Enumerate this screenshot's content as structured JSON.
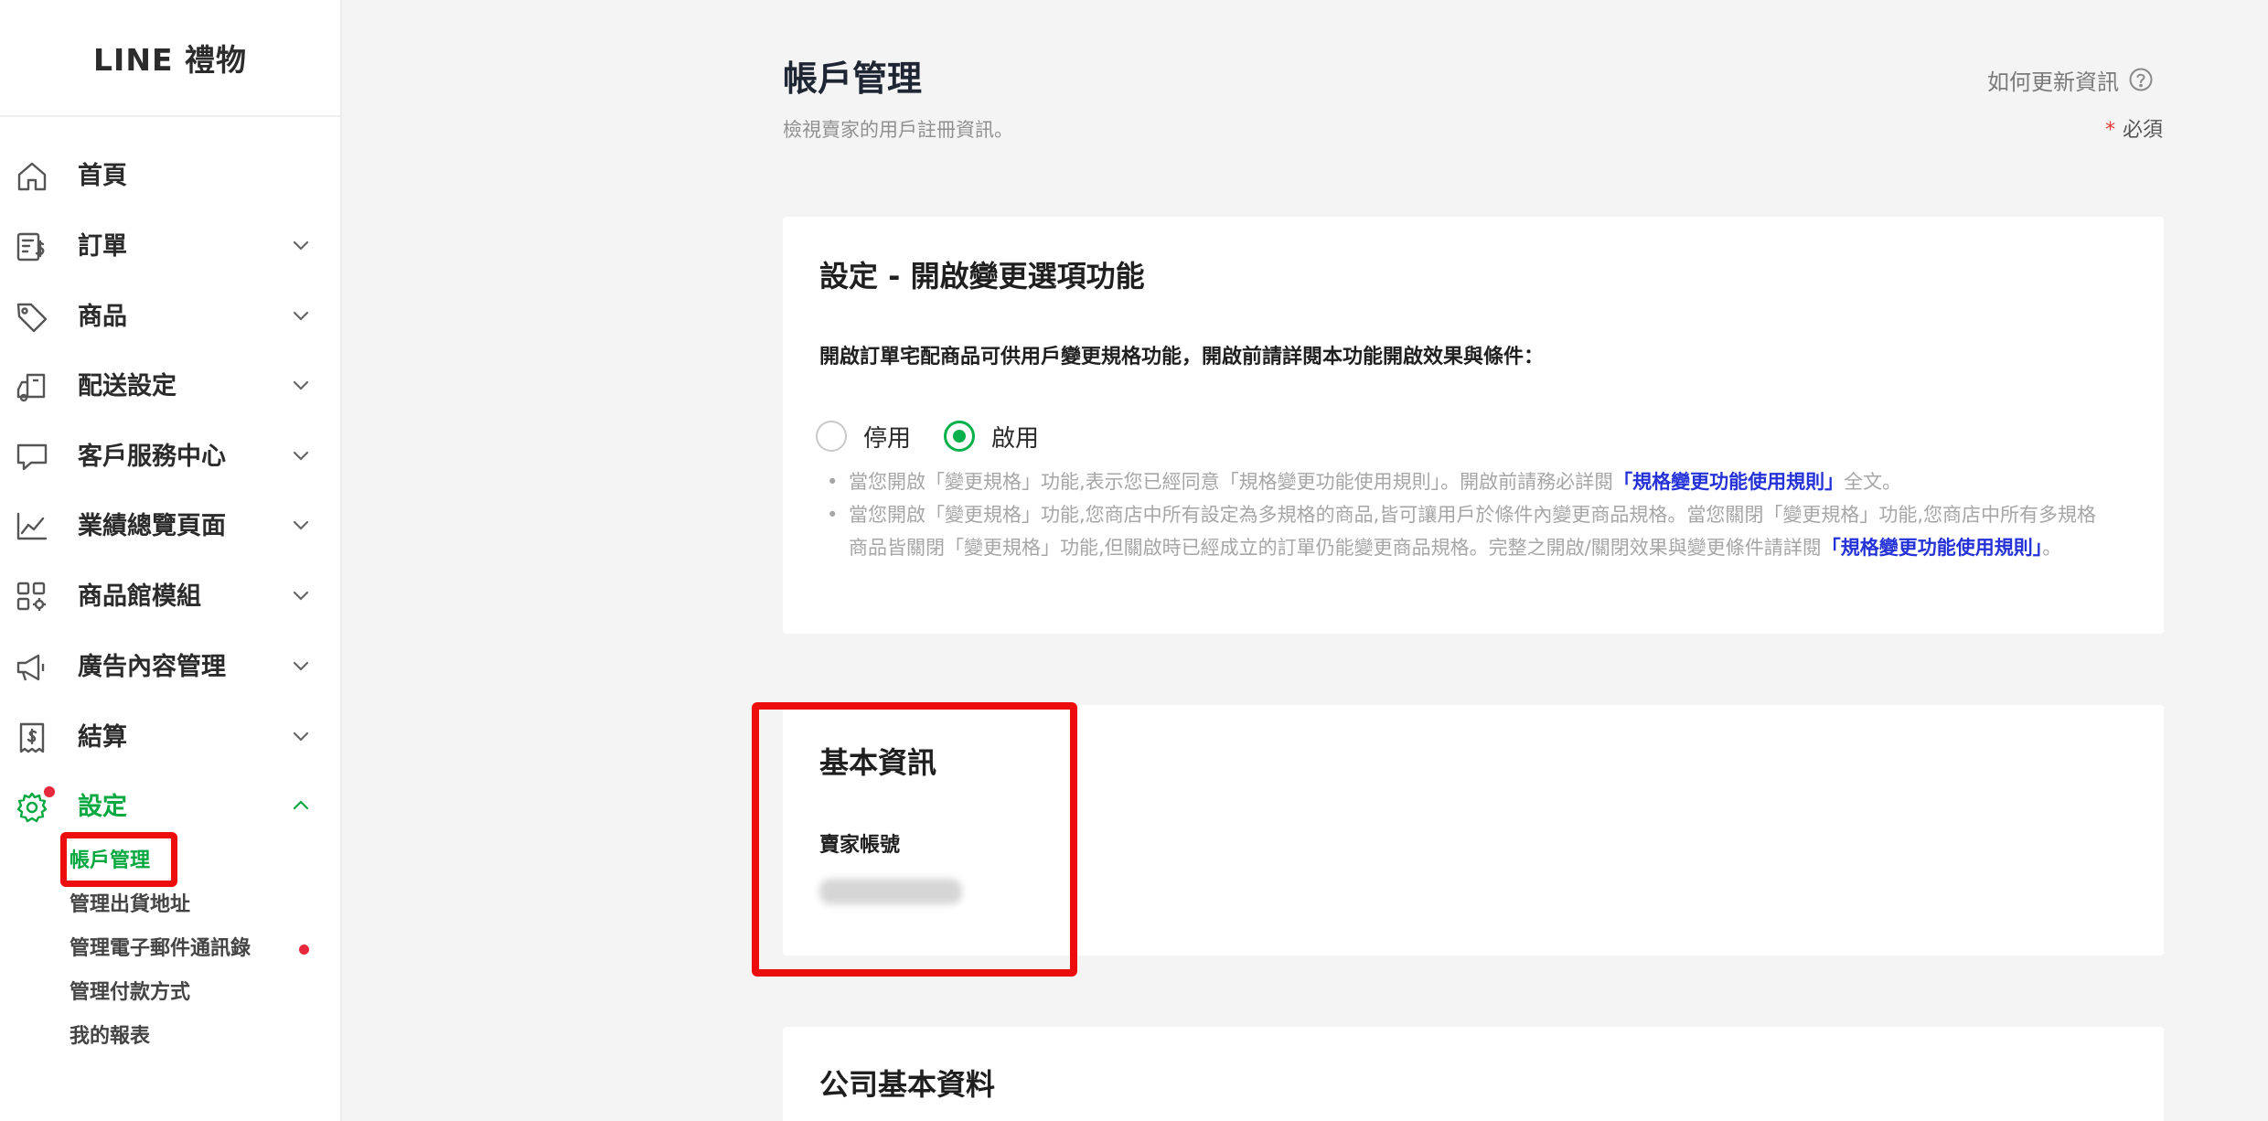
{
  "brand": {
    "logo_text": "LINE 禮物"
  },
  "sidebar": {
    "items": [
      {
        "label": "首頁",
        "icon": "home-icon"
      },
      {
        "label": "訂單",
        "icon": "order-icon"
      },
      {
        "label": "商品",
        "icon": "tag-icon"
      },
      {
        "label": "配送設定",
        "icon": "delivery-icon"
      },
      {
        "label": "客戶服務中心",
        "icon": "chat-icon"
      },
      {
        "label": "業績總覽頁面",
        "icon": "chart-icon"
      },
      {
        "label": "商品館模組",
        "icon": "module-icon"
      },
      {
        "label": "廣告內容管理",
        "icon": "megaphone-icon"
      },
      {
        "label": "結算",
        "icon": "receipt-icon"
      },
      {
        "label": "設定",
        "icon": "gear-icon"
      }
    ],
    "settings_submenu": [
      {
        "label": "帳戶管理"
      },
      {
        "label": "管理出貨地址"
      },
      {
        "label": "管理電子郵件通訊錄"
      },
      {
        "label": "管理付款方式"
      },
      {
        "label": "我的報表"
      }
    ]
  },
  "header": {
    "title": "帳戶管理",
    "subtitle": "檢視賣家的用戶註冊資訊。",
    "help_link": "如何更新資訊",
    "required_star": "*",
    "required_label": "必須"
  },
  "option_card": {
    "title": "設定 - 開啟變更選項功能",
    "description": "開啟訂單宅配商品可供用戶變更規格功能，開啟前請詳閱本功能開啟效果與條件：",
    "radio_options": [
      {
        "label": "停用",
        "checked": false
      },
      {
        "label": "啟用",
        "checked": true
      }
    ],
    "note1_text": "當您開啟「變更規格」功能,表示您已經同意「規格變更功能使用規則」。開啟前請務必詳閱",
    "note1_link": "「規格變更功能使用規則」",
    "note1_suffix": "全文。",
    "note2_text": "當您開啟「變更規格」功能,您商店中所有設定為多規格的商品,皆可讓用戶於條件內變更商品規格。當您關閉「變更規格」功能,您商店中所有多規格商品皆關閉「變更規格」功能,但關啟時已經成立的訂單仍能變更商品規格。完整之開啟/關閉效果與變更條件請詳閱",
    "note2_link": "「規格變更功能使用規則」",
    "note2_suffix": "。"
  },
  "basic_card": {
    "title": "基本資訊",
    "seller_account_label": "賣家帳號"
  },
  "company_card": {
    "title": "公司基本資料"
  },
  "colors": {
    "accent_green": "#06b04a",
    "link_blue": "#2432d8",
    "highlight_red": "#ec0d0d"
  }
}
